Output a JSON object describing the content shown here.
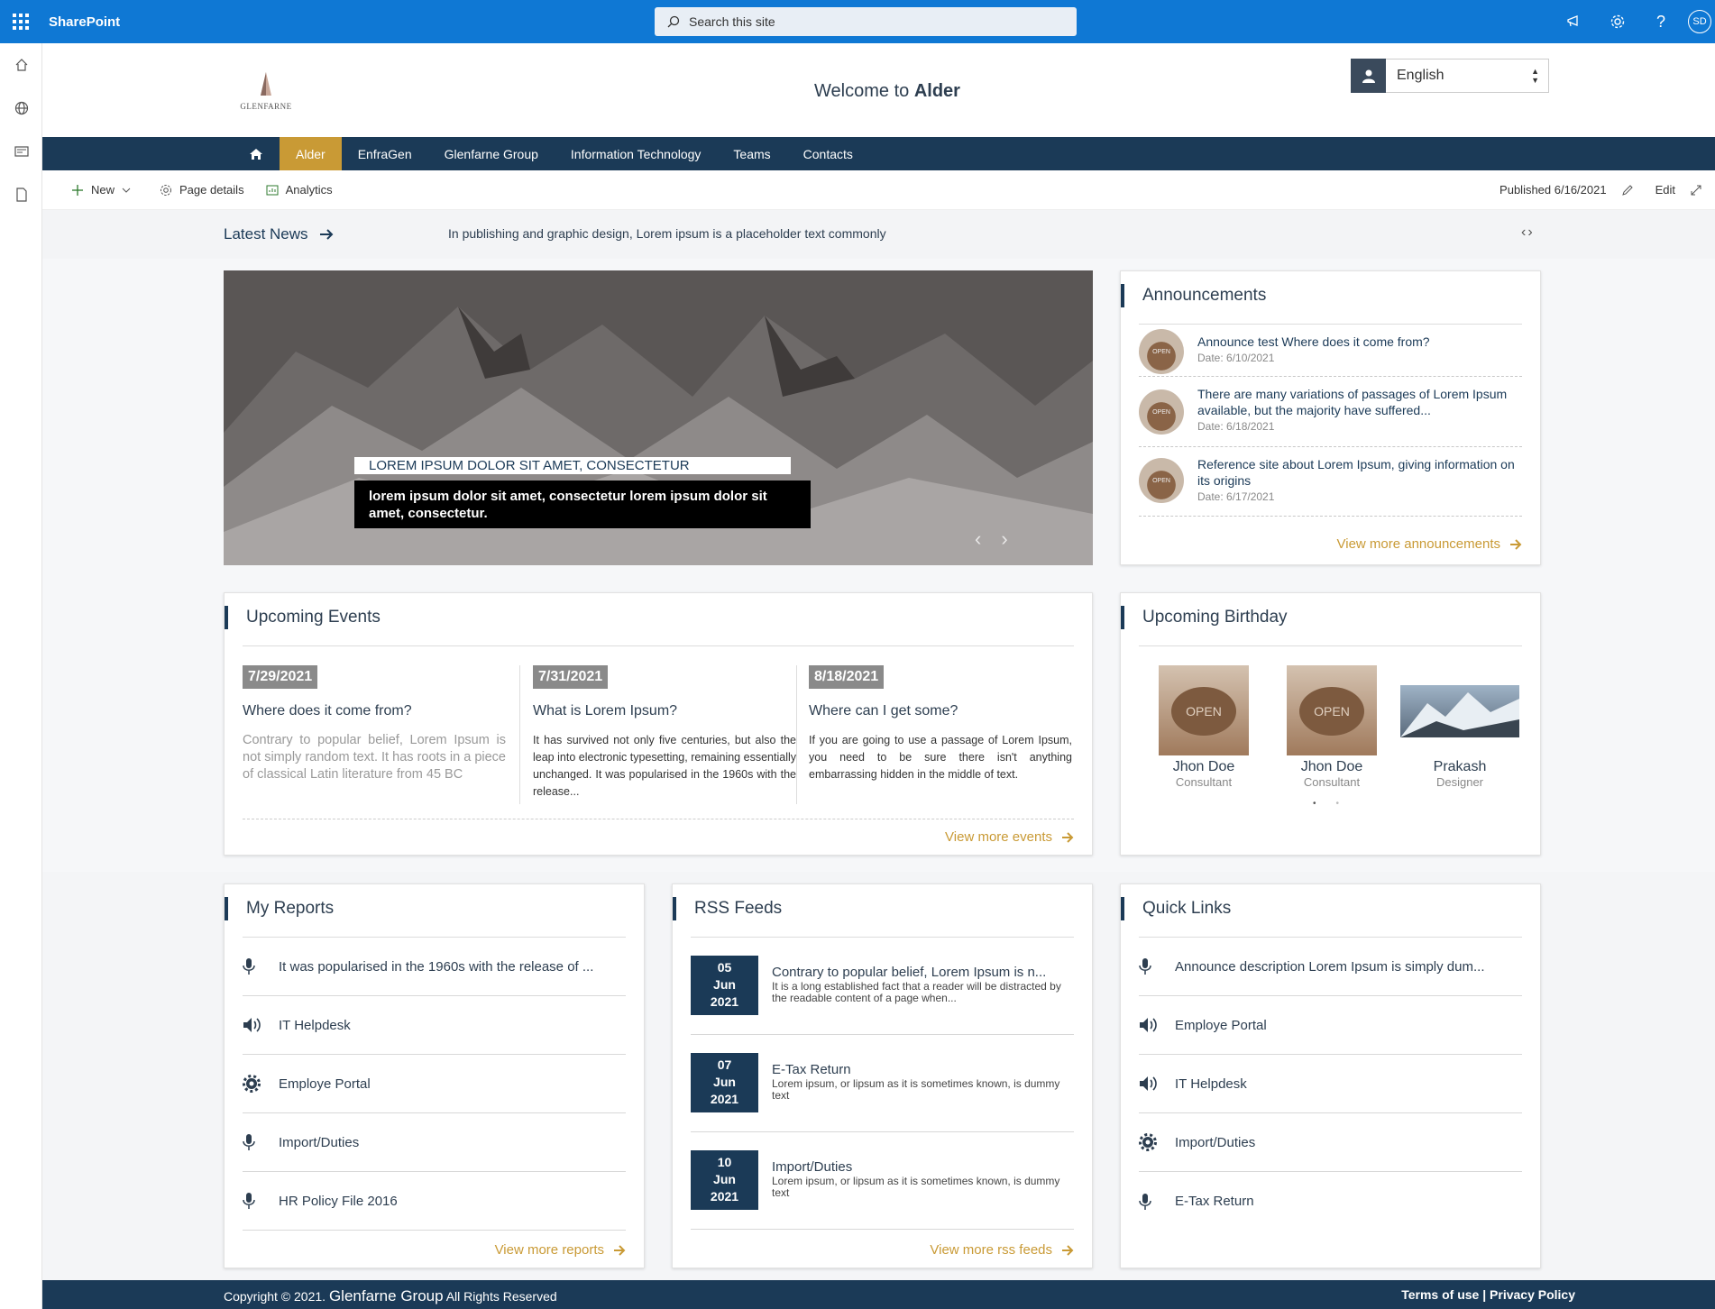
{
  "suite": {
    "brand": "SharePoint",
    "search_placeholder": "Search this site",
    "user_initials": "SD"
  },
  "header": {
    "logo_text": "GLENFARNE",
    "welcome_prefix": "Welcome to",
    "welcome_site": "Alder",
    "language": "English"
  },
  "nav": {
    "items": [
      "Alder",
      "EnfraGen",
      "Glenfarne Group",
      "Information Technology",
      "Teams",
      "Contacts"
    ],
    "active": "Alder"
  },
  "cmdbar": {
    "new_label": "New",
    "page_details_label": "Page details",
    "analytics_label": "Analytics",
    "published": "Published 6/16/2021",
    "edit_label": "Edit"
  },
  "news": {
    "label": "Latest News",
    "ticker": "In publishing and graphic design, Lorem ipsum is a placeholder text commonly"
  },
  "hero": {
    "caption_title": "LOREM IPSUM DOLOR SIT AMET, CONSECTETUR",
    "caption_body": "lorem ipsum dolor sit amet, consectetur lorem ipsum dolor sit amet, consectetur."
  },
  "announcements": {
    "title": "Announcements",
    "items": [
      {
        "text": "Announce test Where does it come from?",
        "date": "Date: 6/10/2021"
      },
      {
        "text": "There are many variations of passages of Lorem Ipsum available, but the majority have suffered...",
        "date": "Date: 6/18/2021"
      },
      {
        "text": "Reference site about Lorem Ipsum, giving information on its origins",
        "date": "Date: 6/17/2021"
      }
    ],
    "thumb_label": "OPEN",
    "view_more": "View more announcements"
  },
  "events": {
    "title": "Upcoming Events",
    "items": [
      {
        "date": "7/29/2021",
        "title": "Where does it come from?",
        "desc": "Contrary to popular belief, Lorem Ipsum is not simply random text. It has roots in a piece of classical Latin literature from 45 BC"
      },
      {
        "date": "7/31/2021",
        "title": "What is Lorem Ipsum?",
        "desc": "It has survived not only five centuries, but also the leap into electronic typesetting, remaining essentially unchanged. It was popularised in the 1960s with the release..."
      },
      {
        "date": "8/18/2021",
        "title": "Where can I get some?",
        "desc": "If you are going to use a passage of Lorem Ipsum, you need to be sure there isn't anything embarrassing hidden in the middle of text."
      }
    ],
    "view_more": "View more events"
  },
  "birthday": {
    "title": "Upcoming Birthday",
    "people": [
      {
        "name": "Jhon Doe",
        "role": "Consultant"
      },
      {
        "name": "Jhon Doe",
        "role": "Consultant"
      },
      {
        "name": "Prakash",
        "role": "Designer"
      }
    ],
    "sign_label": "OPEN"
  },
  "reports": {
    "title": "My Reports",
    "items": [
      {
        "label": "It was popularised in the 1960s with the release of ...",
        "icon": "microphone-icon"
      },
      {
        "label": "IT Helpdesk",
        "icon": "speaker-icon"
      },
      {
        "label": "Employe Portal",
        "icon": "gear-icon"
      },
      {
        "label": "Import/Duties",
        "icon": "microphone-icon"
      },
      {
        "label": "HR Policy File 2016",
        "icon": "microphone-icon"
      }
    ],
    "view_more": "View more reports"
  },
  "rss": {
    "title": "RSS Feeds",
    "items": [
      {
        "day": "05",
        "month": "Jun",
        "year": "2021",
        "title": "Contrary to popular belief, Lorem Ipsum is n...",
        "desc": "It is a long established fact that a reader will be distracted by the readable content of a page when..."
      },
      {
        "day": "07",
        "month": "Jun",
        "year": "2021",
        "title": "E-Tax Return",
        "desc": "Lorem ipsum, or lipsum as it is sometimes known, is dummy text"
      },
      {
        "day": "10",
        "month": "Jun",
        "year": "2021",
        "title": "Import/Duties",
        "desc": "Lorem ipsum, or lipsum as it is sometimes known, is dummy text"
      }
    ],
    "view_more": "View more rss feeds"
  },
  "quicklinks": {
    "title": "Quick Links",
    "items": [
      {
        "label": "Announce description Lorem Ipsum is simply dum...",
        "icon": "microphone-icon"
      },
      {
        "label": "Employe Portal",
        "icon": "speaker-icon"
      },
      {
        "label": "IT Helpdesk",
        "icon": "speaker-icon"
      },
      {
        "label": "Import/Duties",
        "icon": "gear-icon"
      },
      {
        "label": "E-Tax Return",
        "icon": "microphone-icon"
      }
    ]
  },
  "footer": {
    "copyright": "Copyright © 2021.",
    "company": "Glenfarne Group",
    "rights": "All Rights Reserved",
    "terms": "Terms of use",
    "privacy": "Privacy Policy"
  },
  "colors": {
    "suite_blue": "#0f78d4",
    "navy": "#1b3a57",
    "gold": "#c99a35"
  }
}
